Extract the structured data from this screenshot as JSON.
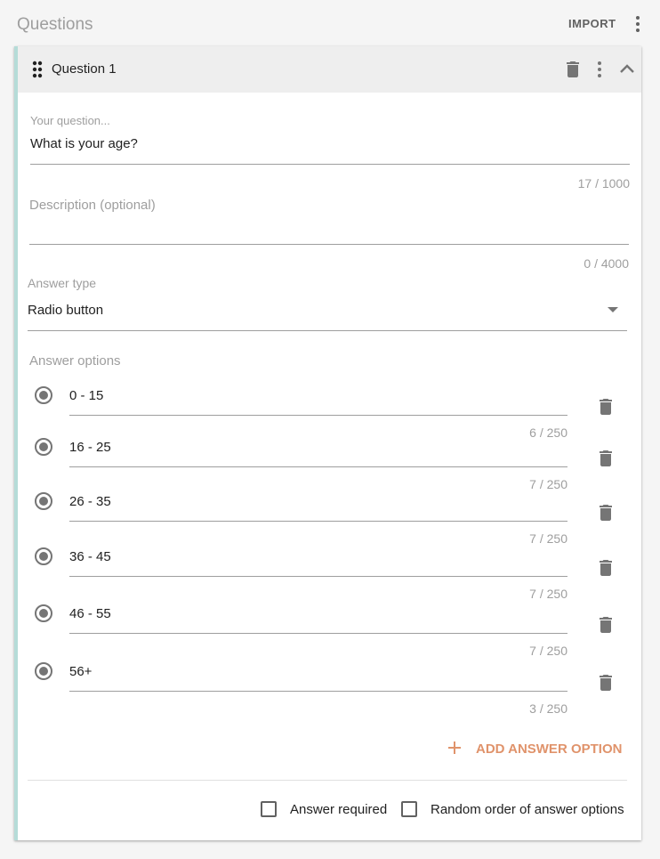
{
  "page": {
    "title": "Questions",
    "import_label": "IMPORT"
  },
  "question": {
    "title": "Question 1",
    "question_field": {
      "label": "Your question...",
      "value": "What is your age?",
      "counter": "17 / 1000"
    },
    "description_field": {
      "placeholder": "Description (optional)",
      "counter": "0 / 4000"
    },
    "answer_type": {
      "label": "Answer type",
      "value": "Radio button"
    },
    "answer_options_label": "Answer options",
    "options": [
      {
        "value": "0 - 15",
        "counter": "6 / 250"
      },
      {
        "value": "16 - 25",
        "counter": "7 / 250"
      },
      {
        "value": "26 - 35",
        "counter": "7 / 250"
      },
      {
        "value": "36 - 45",
        "counter": "7 / 250"
      },
      {
        "value": "46 - 55",
        "counter": "7 / 250"
      },
      {
        "value": "56+",
        "counter": "3 / 250"
      }
    ],
    "add_option_label": "ADD ANSWER OPTION",
    "answer_required_label": "Answer required",
    "random_order_label": "Random order of answer options"
  },
  "colors": {
    "accent_bar": "#b5dcd8",
    "add_option": "#e0936b",
    "icon": "#757575"
  },
  "icons": {
    "more_top": "more-vert-icon",
    "drag": "drag-handle-icon",
    "delete": "trash-icon",
    "more": "more-vert-icon",
    "collapse": "chevron-up-icon",
    "radio": "radio-checked-icon",
    "dropdown": "dropdown-arrow-icon",
    "add": "plus-icon"
  }
}
